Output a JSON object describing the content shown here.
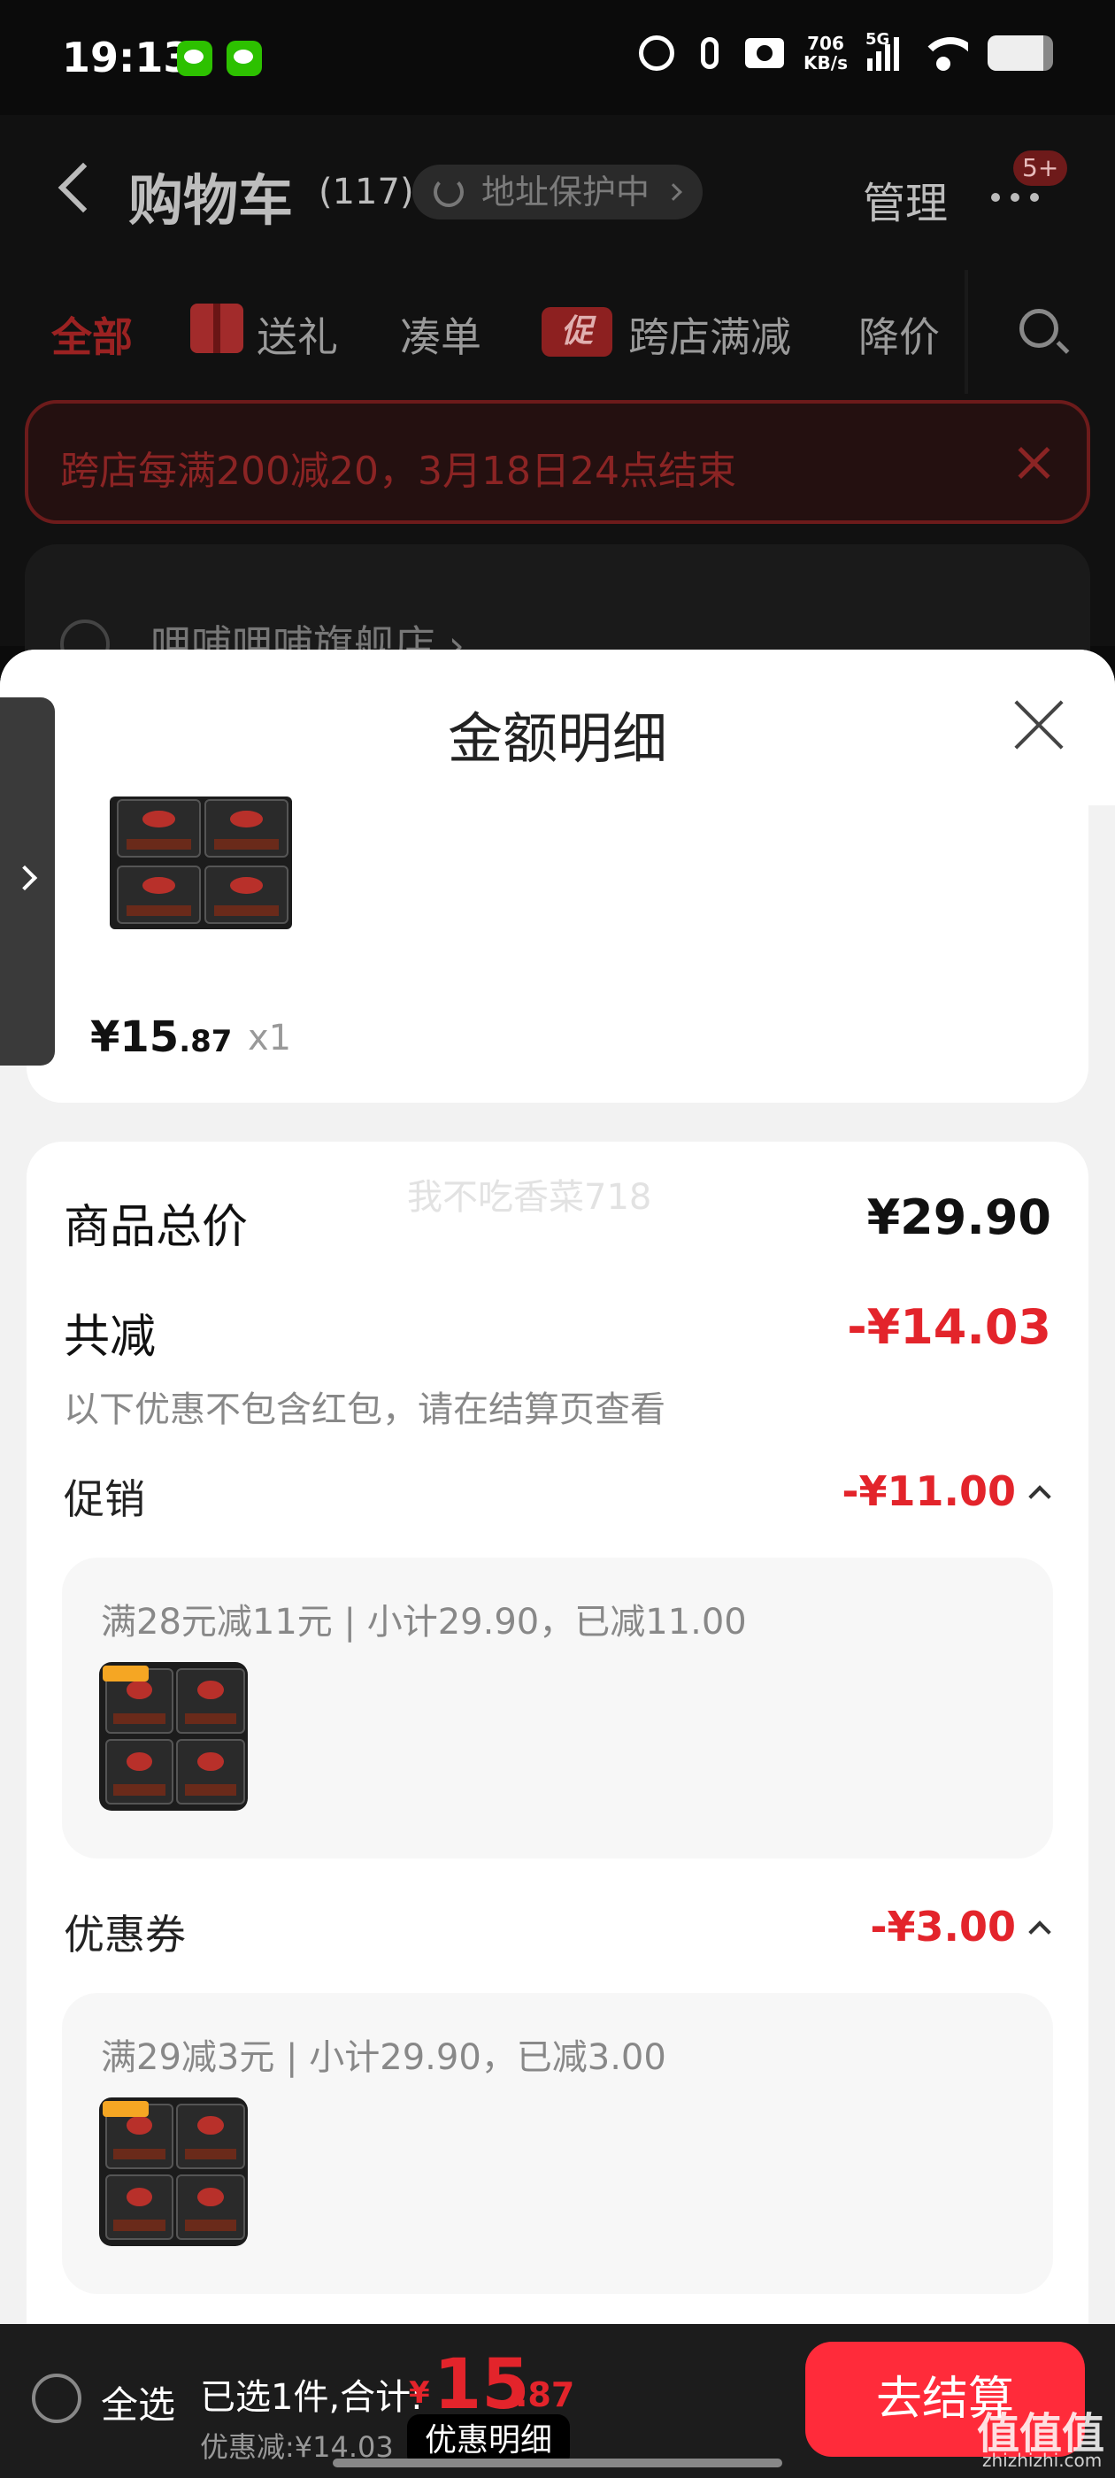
{
  "status": {
    "time": "19:13",
    "speed_value": "706",
    "speed_unit": "KB/s",
    "network": "5G",
    "battery_level": 0.85,
    "icons": [
      "wechat-icon",
      "wechat-icon",
      "alarm-icon",
      "mic-icon",
      "camera-icon",
      "signal-icon",
      "wifi-icon",
      "battery-icon"
    ]
  },
  "nav": {
    "title": "购物车",
    "count": "(117)",
    "address": "地址保护中",
    "manage": "管理",
    "badge": "5+"
  },
  "tabs": [
    {
      "label": "全部",
      "active": true
    },
    {
      "label": "送礼"
    },
    {
      "label": "凑单"
    },
    {
      "label": "跨店满减",
      "icon_text": "促"
    },
    {
      "label": "降价"
    }
  ],
  "banner": {
    "text": "跨店每满200减20，3月18日24点结束"
  },
  "shop": {
    "name": "呷哺呷哺旗舰店 ›"
  },
  "sheet": {
    "title": "金额明细",
    "item": {
      "price_int": "¥15",
      "price_dec": ".87",
      "qty": "x1"
    },
    "watermark": "我不吃香菜718",
    "total_label": "商品总价",
    "total_value": "¥29.90",
    "reduce_label": "共减",
    "reduce_value": "-¥14.03",
    "note": "以下优惠不包含红包，请在结算页查看",
    "promo": {
      "label": "促销",
      "value": "-¥11.00",
      "desc": "满28元减11元 | 小计29.90，已减11.00"
    },
    "coupon": {
      "label": "优惠券",
      "value": "-¥3.00",
      "desc": "满29减3元 | 小计29.90，已减3.00"
    }
  },
  "bottom": {
    "select_all": "全选",
    "selected": "已选1件,合计:",
    "currency": "¥",
    "price_int": "15",
    "price_dec": ".87",
    "saved": "优惠减:¥14.03",
    "detail_button": "优惠明细",
    "checkout": "去结算"
  },
  "watermark": {
    "cn": "值值值",
    "domain": "zhizhizhi.com"
  }
}
